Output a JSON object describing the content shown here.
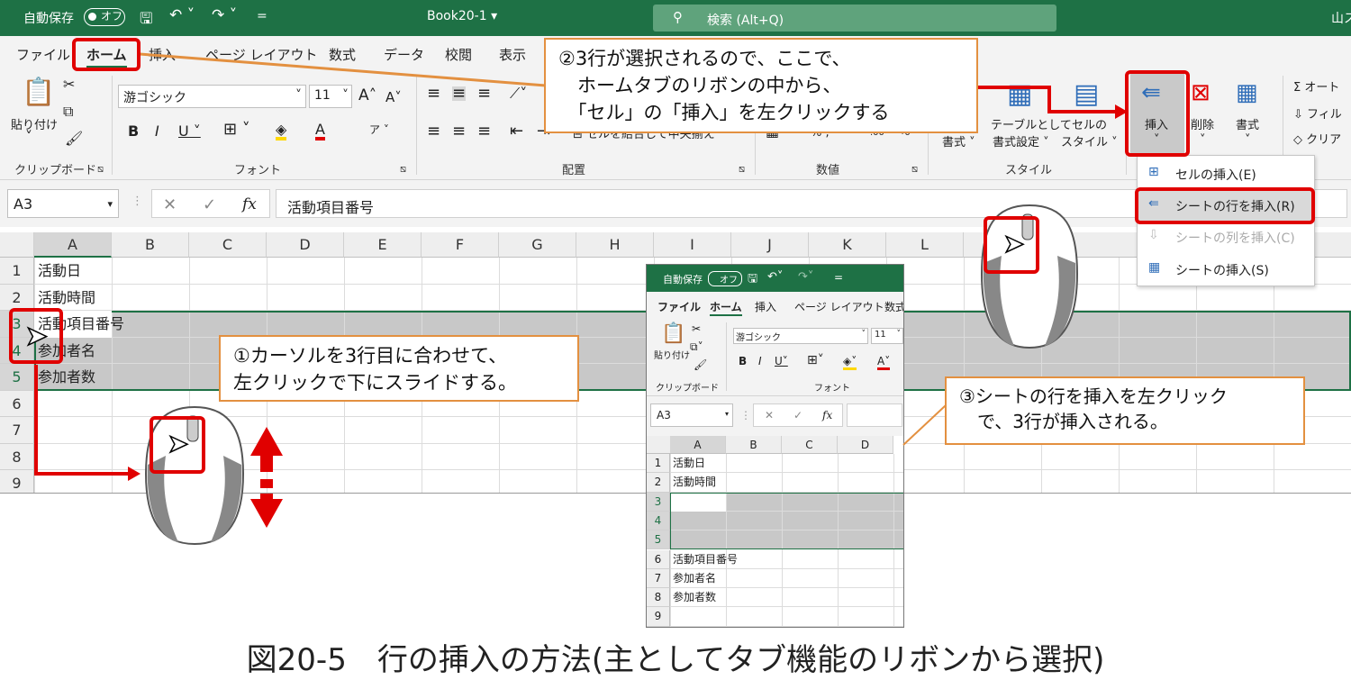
{
  "titlebar": {
    "autosave_label": "自動保存",
    "autosave_state": "オフ",
    "book_title": "Book20-1",
    "search_placeholder": "検索 (Alt+Q)",
    "user": "山ス"
  },
  "tabs": [
    "ファイル",
    "ホーム",
    "挿入",
    "ページ レイアウト",
    "数式",
    "データ",
    "校閲",
    "表示"
  ],
  "ribbon": {
    "paste": "貼り付け",
    "clipboard_group": "クリップボード",
    "font_name": "游ゴシック",
    "font_size": "11",
    "font_group": "フォント",
    "align_group": "配置",
    "merge_label": "セルを結合して中央揃え",
    "number_group": "数値",
    "number_fmt": "% ,",
    "cond_format": "書式",
    "table_format_1": "テーブルとして",
    "table_format_2": "書式設定",
    "cell_style_1": "セルの",
    "cell_style_2": "スタイル",
    "style_group": "スタイル",
    "insert": "挿入",
    "delete": "削除",
    "format": "書式",
    "autosum": "オート",
    "fill": "フィル",
    "clear": "クリア"
  },
  "formula_bar": {
    "name_box": "A3",
    "fx": "fx",
    "content": "活動項目番号"
  },
  "sheet": {
    "columns": [
      "A",
      "B",
      "C",
      "D",
      "E",
      "F",
      "G",
      "H",
      "I",
      "J",
      "K",
      "L"
    ],
    "rows": [
      "1",
      "2",
      "3",
      "4",
      "5",
      "6",
      "7",
      "8",
      "9"
    ],
    "cells": [
      "活動日",
      "活動時間",
      "活動項目番号",
      "参加者名",
      "参加者数"
    ]
  },
  "dropdown": {
    "items": [
      "セルの挿入(E)",
      "シートの行を挿入(R)",
      "シートの列を挿入(C)",
      "シートの挿入(S)"
    ]
  },
  "inner": {
    "autosave_label": "自動保存",
    "autosave_state": "オフ",
    "tabs": [
      "ファイル",
      "ホーム",
      "挿入",
      "ページ レイアウト",
      "数式"
    ],
    "paste": "貼り付け",
    "clipboard_group": "クリップボード",
    "font_name": "游ゴシック",
    "font_size": "11",
    "font_group": "フォント",
    "name_box": "A3",
    "fx": "fx",
    "columns": [
      "A",
      "B",
      "C",
      "D"
    ],
    "rows": [
      "1",
      "2",
      "3",
      "4",
      "5",
      "6",
      "7",
      "8",
      "9"
    ],
    "cells": [
      "活動日",
      "活動時間",
      "",
      "",
      "",
      "活動項目番号",
      "参加者名",
      "参加者数",
      ""
    ]
  },
  "callouts": {
    "step1": "①カーソルを3行目に合わせて、\n左クリックで下にスライドする。",
    "step2": "②3行が選択されるので、ここで、\n　ホームタブのリボンの中から、\n　「セル」の「挿入」を左クリックする",
    "step3": "③シートの行を挿入を左クリック\n　で、3行が挿入される。"
  },
  "caption": "図20-5　行の挿入の方法(主としてタブ機能のリボンから選択)",
  "colors": {
    "excel_green": "#1e7145",
    "highlight_red": "#e00000",
    "callout_border": "#e39040",
    "selection_gray": "#c8c8c8"
  }
}
